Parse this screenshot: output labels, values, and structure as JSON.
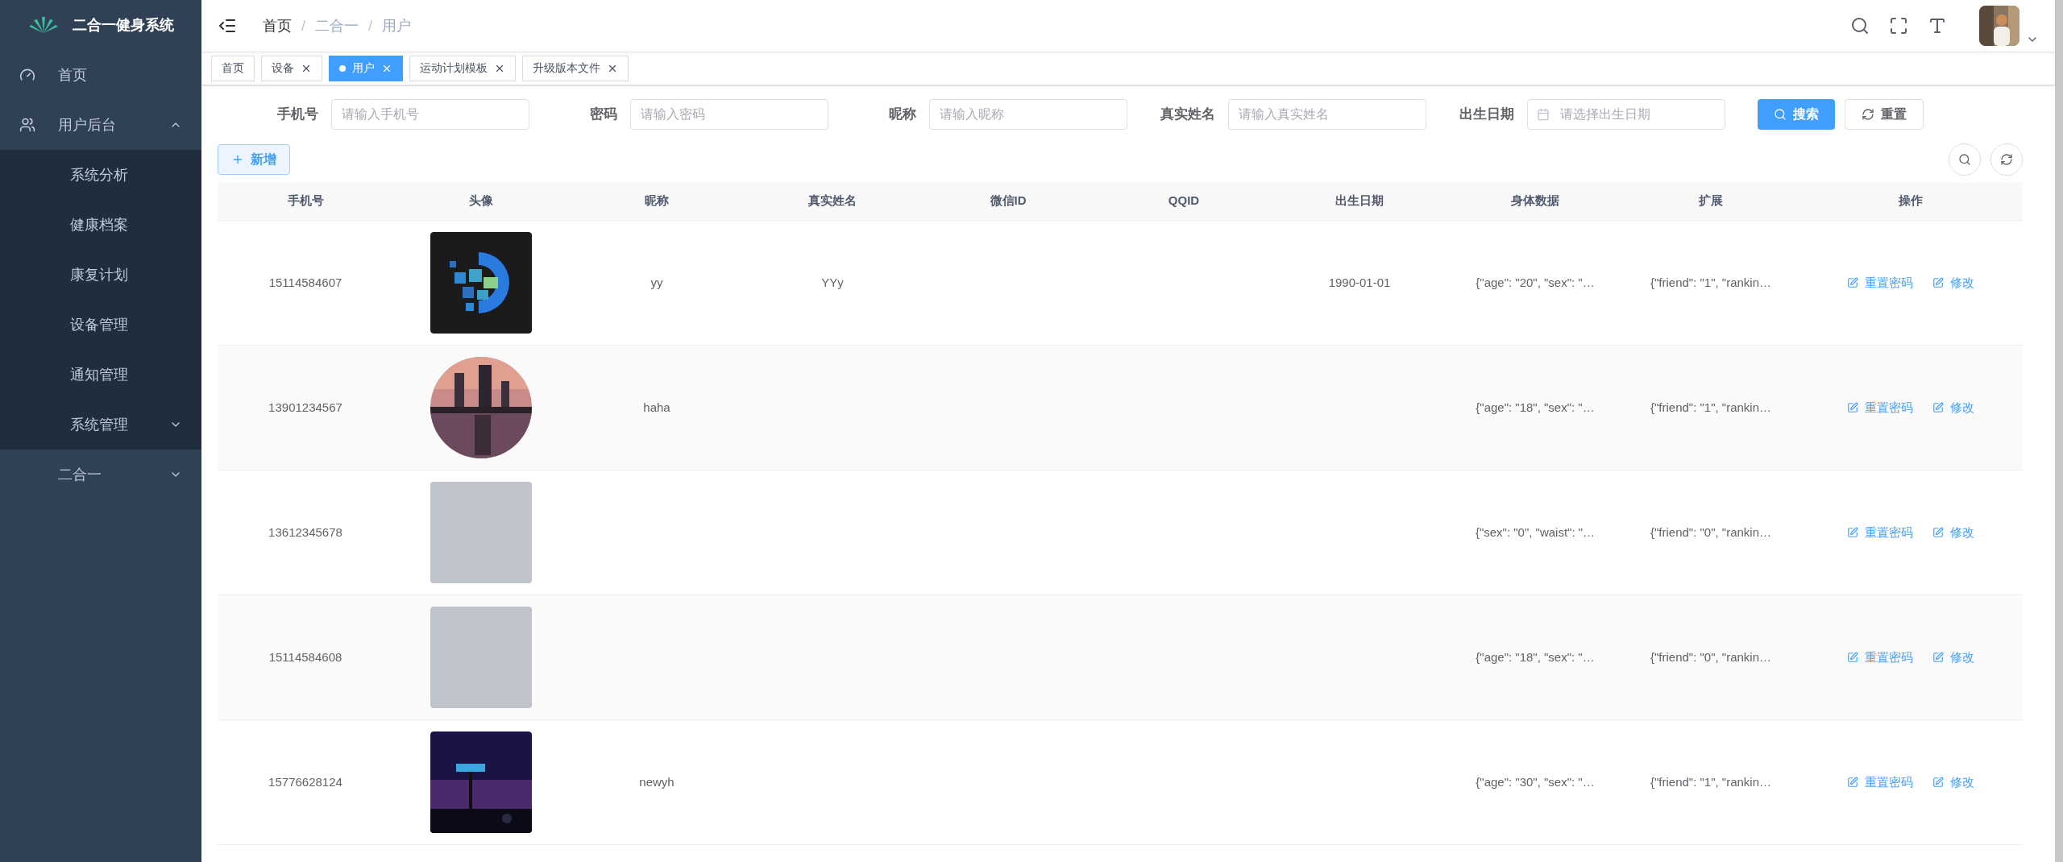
{
  "sidebar": {
    "title": "二合一健身系统",
    "items": [
      {
        "label": "首页",
        "expandable": false
      },
      {
        "label": "用户后台",
        "expandable": true,
        "expanded": true,
        "children": [
          {
            "label": "系统分析"
          },
          {
            "label": "健康档案"
          },
          {
            "label": "康复计划"
          },
          {
            "label": "设备管理"
          },
          {
            "label": "通知管理"
          },
          {
            "label": "系统管理",
            "expandable": true,
            "expanded": false
          }
        ]
      },
      {
        "label": "二合一",
        "expandable": true,
        "expanded": false
      }
    ]
  },
  "breadcrumb": {
    "separator": "/",
    "items": [
      "首页",
      "二合一",
      "用户"
    ]
  },
  "tabs": [
    {
      "label": "首页",
      "selected": false,
      "closable": false
    },
    {
      "label": "设备",
      "selected": false,
      "closable": true
    },
    {
      "label": "用户",
      "selected": true,
      "closable": true
    },
    {
      "label": "运动计划模板",
      "selected": false,
      "closable": true
    },
    {
      "label": "升级版本文件",
      "selected": false,
      "closable": true
    }
  ],
  "filters": [
    {
      "label": "手机号",
      "placeholder": "请输入手机号",
      "kind": "text"
    },
    {
      "label": "密码",
      "placeholder": "请输入密码",
      "kind": "text"
    },
    {
      "label": "昵称",
      "placeholder": "请输入昵称",
      "kind": "text"
    },
    {
      "label": "真实姓名",
      "placeholder": "请输入真实姓名",
      "kind": "text"
    },
    {
      "label": "出生日期",
      "placeholder": "请选择出生日期",
      "kind": "date"
    }
  ],
  "search_button": "搜索",
  "reset_button": "重置",
  "add_button": "新增",
  "table": {
    "columns": [
      "手机号",
      "头像",
      "昵称",
      "真实姓名",
      "微信ID",
      "QQID",
      "出生日期",
      "身体数据",
      "扩展",
      "操作"
    ],
    "rows": [
      {
        "phone": "15114584607",
        "avatar": {
          "kind": "picture"
        },
        "nickname": "yy",
        "real_name": "YYy",
        "birth": "1990-01-01",
        "body": "{\"age\": \"20\", \"sex\": \"…",
        "ext": "{\"friend\": \"1\", \"rankin…",
        "actions": [
          "重置密码",
          "修改"
        ]
      },
      {
        "phone": "13901234567",
        "avatar": {
          "kind": "picture"
        },
        "nickname": "haha",
        "body": "{\"age\": \"18\", \"sex\": \"…",
        "ext": "{\"friend\": \"1\", \"rankin…",
        "actions": [
          "重置密码",
          "修改"
        ]
      },
      {
        "phone": "13612345678",
        "avatar": {
          "kind": "blank"
        },
        "body": "{\"sex\": \"0\", \"waist\": \"…",
        "ext": "{\"friend\": \"0\", \"rankin…",
        "actions": [
          "重置密码",
          "修改"
        ]
      },
      {
        "phone": "15114584608",
        "avatar": {
          "kind": "blank"
        },
        "body": "{\"age\": \"18\", \"sex\": \"…",
        "ext": "{\"friend\": \"0\", \"rankin…",
        "actions": [
          "重置密码",
          "修改"
        ]
      },
      {
        "phone": "15776628124",
        "avatar": {
          "kind": "picture"
        },
        "nickname": "newyh",
        "body": "{\"age\": \"30\", \"sex\": \"…",
        "ext": "{\"friend\": \"1\", \"rankin…",
        "actions": [
          "重置密码",
          "修改"
        ]
      }
    ]
  }
}
